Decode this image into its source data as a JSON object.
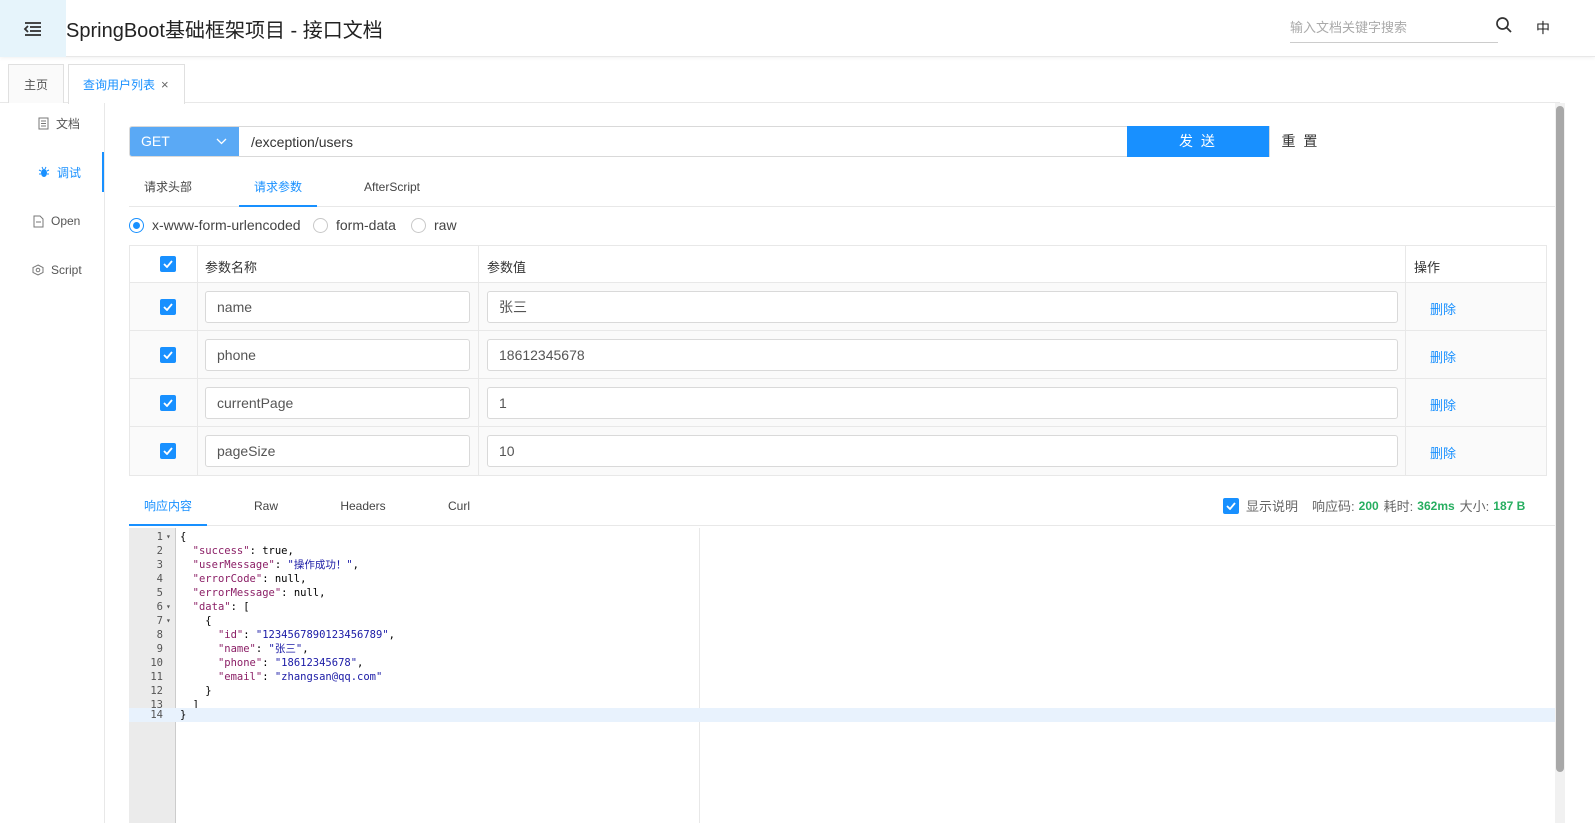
{
  "header": {
    "title": "SpringBoot基础框架项目 - 接口文档",
    "search_placeholder": "输入文档关键字搜索",
    "lang": "中",
    "menu_icon": "menu-fold-icon",
    "search_icon": "search-icon"
  },
  "tabs": {
    "home": "主页",
    "active": "查询用户列表",
    "close": "×"
  },
  "sidebar": {
    "items": [
      {
        "label": "文档",
        "icon": "document-icon"
      },
      {
        "label": "调试",
        "icon": "bug-icon"
      },
      {
        "label": "Open",
        "icon": "file-icon"
      },
      {
        "label": "Script",
        "icon": "code-icon"
      }
    ]
  },
  "request": {
    "method": "GET",
    "url": "/exception/users",
    "send": "发 送",
    "reset": "重 置"
  },
  "subtabs": [
    "请求头部",
    "请求参数",
    "AfterScript"
  ],
  "body_types": [
    "x-www-form-urlencoded",
    "form-data",
    "raw"
  ],
  "params": {
    "headers": {
      "name": "参数名称",
      "value": "参数值",
      "action": "操作"
    },
    "rows": [
      {
        "name": "name",
        "value": "张三",
        "action": "删除"
      },
      {
        "name": "phone",
        "value": "18612345678",
        "action": "删除"
      },
      {
        "name": "currentPage",
        "value": "1",
        "action": "删除"
      },
      {
        "name": "pageSize",
        "value": "10",
        "action": "删除"
      }
    ]
  },
  "response": {
    "tabs": [
      "响应内容",
      "Raw",
      "Headers",
      "Curl"
    ],
    "show_desc": "显示说明",
    "code_label": "响应码:",
    "code": "200",
    "time_label": "耗时:",
    "time": "362ms",
    "size_label": "大小:",
    "size": "187 B"
  },
  "colors": {
    "accent": "#1890ff",
    "method_bg": "#5aa9f5",
    "success": "#27ae60"
  }
}
